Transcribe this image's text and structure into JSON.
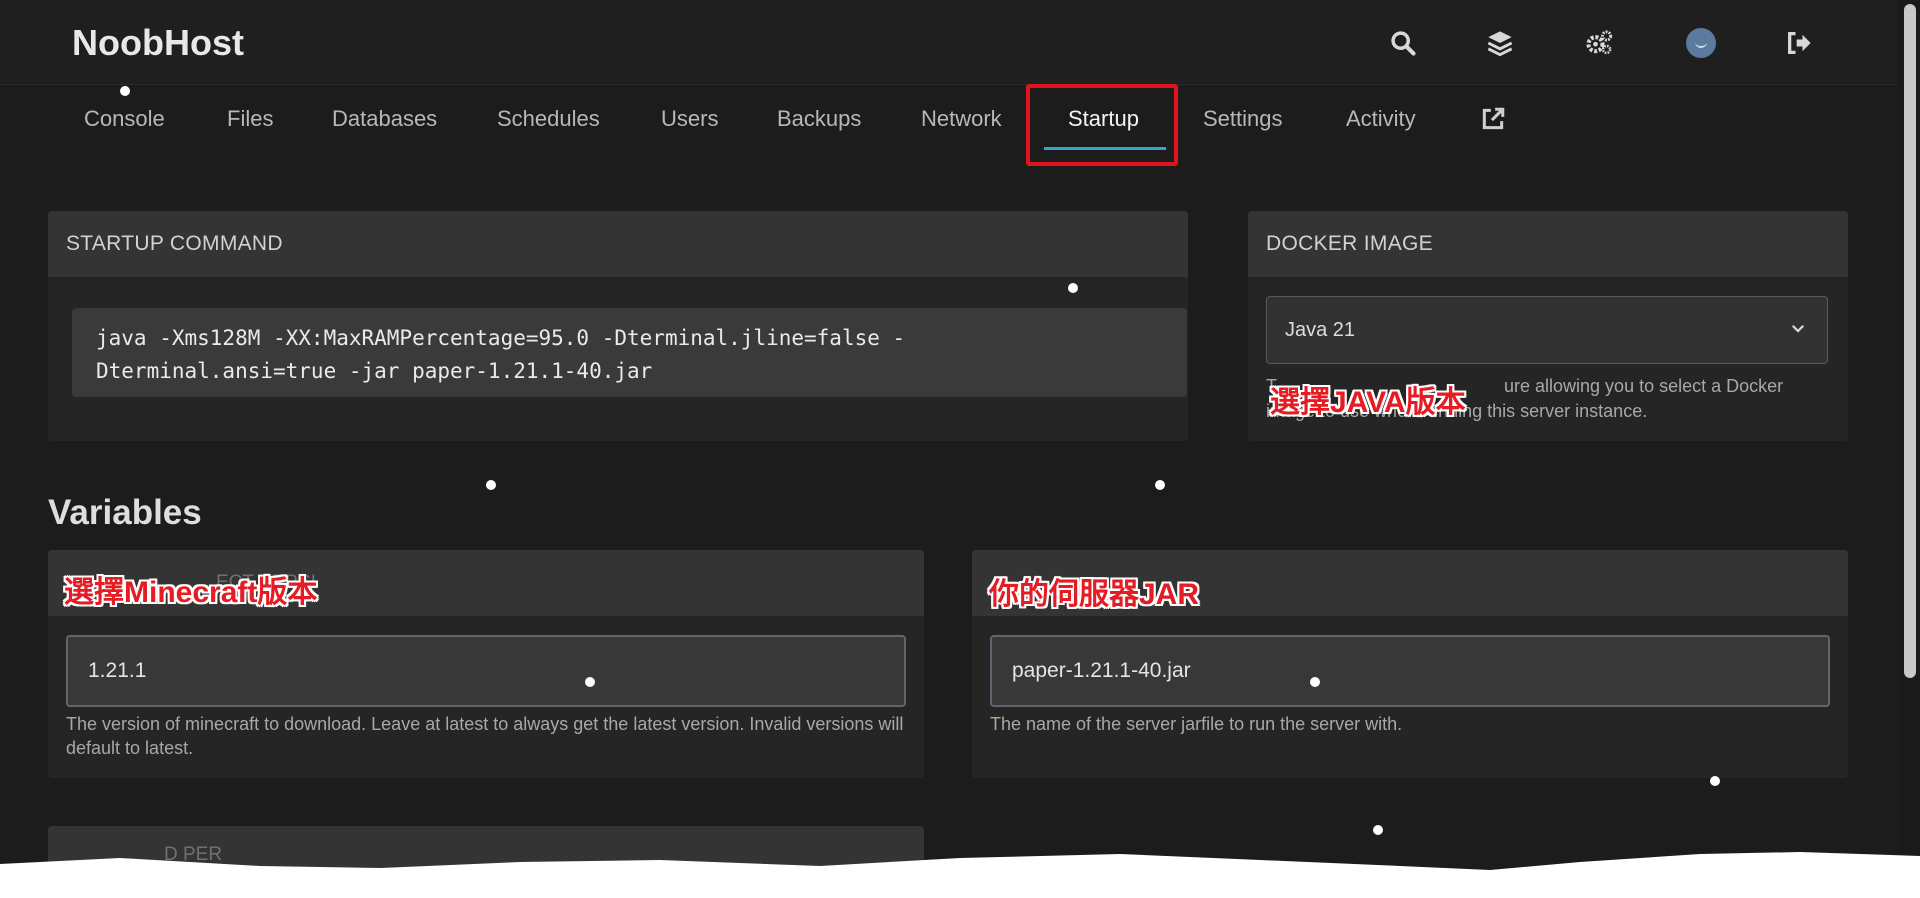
{
  "header": {
    "brand": "NoobHost",
    "icons": [
      "search-icon",
      "layers-icon",
      "cogs-icon",
      "avatar",
      "sign-out-icon"
    ]
  },
  "tabs": [
    {
      "label": "Console"
    },
    {
      "label": "Files"
    },
    {
      "label": "Databases"
    },
    {
      "label": "Schedules"
    },
    {
      "label": "Users"
    },
    {
      "label": "Backups"
    },
    {
      "label": "Network"
    },
    {
      "label": "Startup",
      "active": true
    },
    {
      "label": "Settings"
    },
    {
      "label": "Activity"
    }
  ],
  "startup": {
    "title": "STARTUP COMMAND",
    "command": "java -Xms128M -XX:MaxRAMPercentage=95.0 -Dterminal.jline=false -\nDterminal.ansi=true -jar paper-1.21.1-40.jar"
  },
  "docker": {
    "title": "DOCKER IMAGE",
    "selected": "Java 21",
    "help_left": "T",
    "help_right": "ure allowing you to select a Docker",
    "help_line2": "image to use when running this server instance.",
    "annotation": "選擇JAVA版本"
  },
  "variables": {
    "title": "Variables",
    "items": [
      {
        "annotation": "選擇Minecraft版本",
        "ghost_label": "ECT VERSI",
        "value": "1.21.1",
        "help": "The version of minecraft to download. Leave at latest to always get the latest version. Invalid versions will default to latest."
      },
      {
        "annotation": "你的伺服器JAR",
        "value": "paper-1.21.1-40.jar",
        "help": "The name of the server jarfile to run the server with."
      }
    ],
    "ghost_bottom": "D PER"
  },
  "colors": {
    "background": "#1c1c1c",
    "card": "#252525",
    "card_header": "#343434",
    "accent": "#31a8c9",
    "highlight_red": "#e0121c"
  }
}
